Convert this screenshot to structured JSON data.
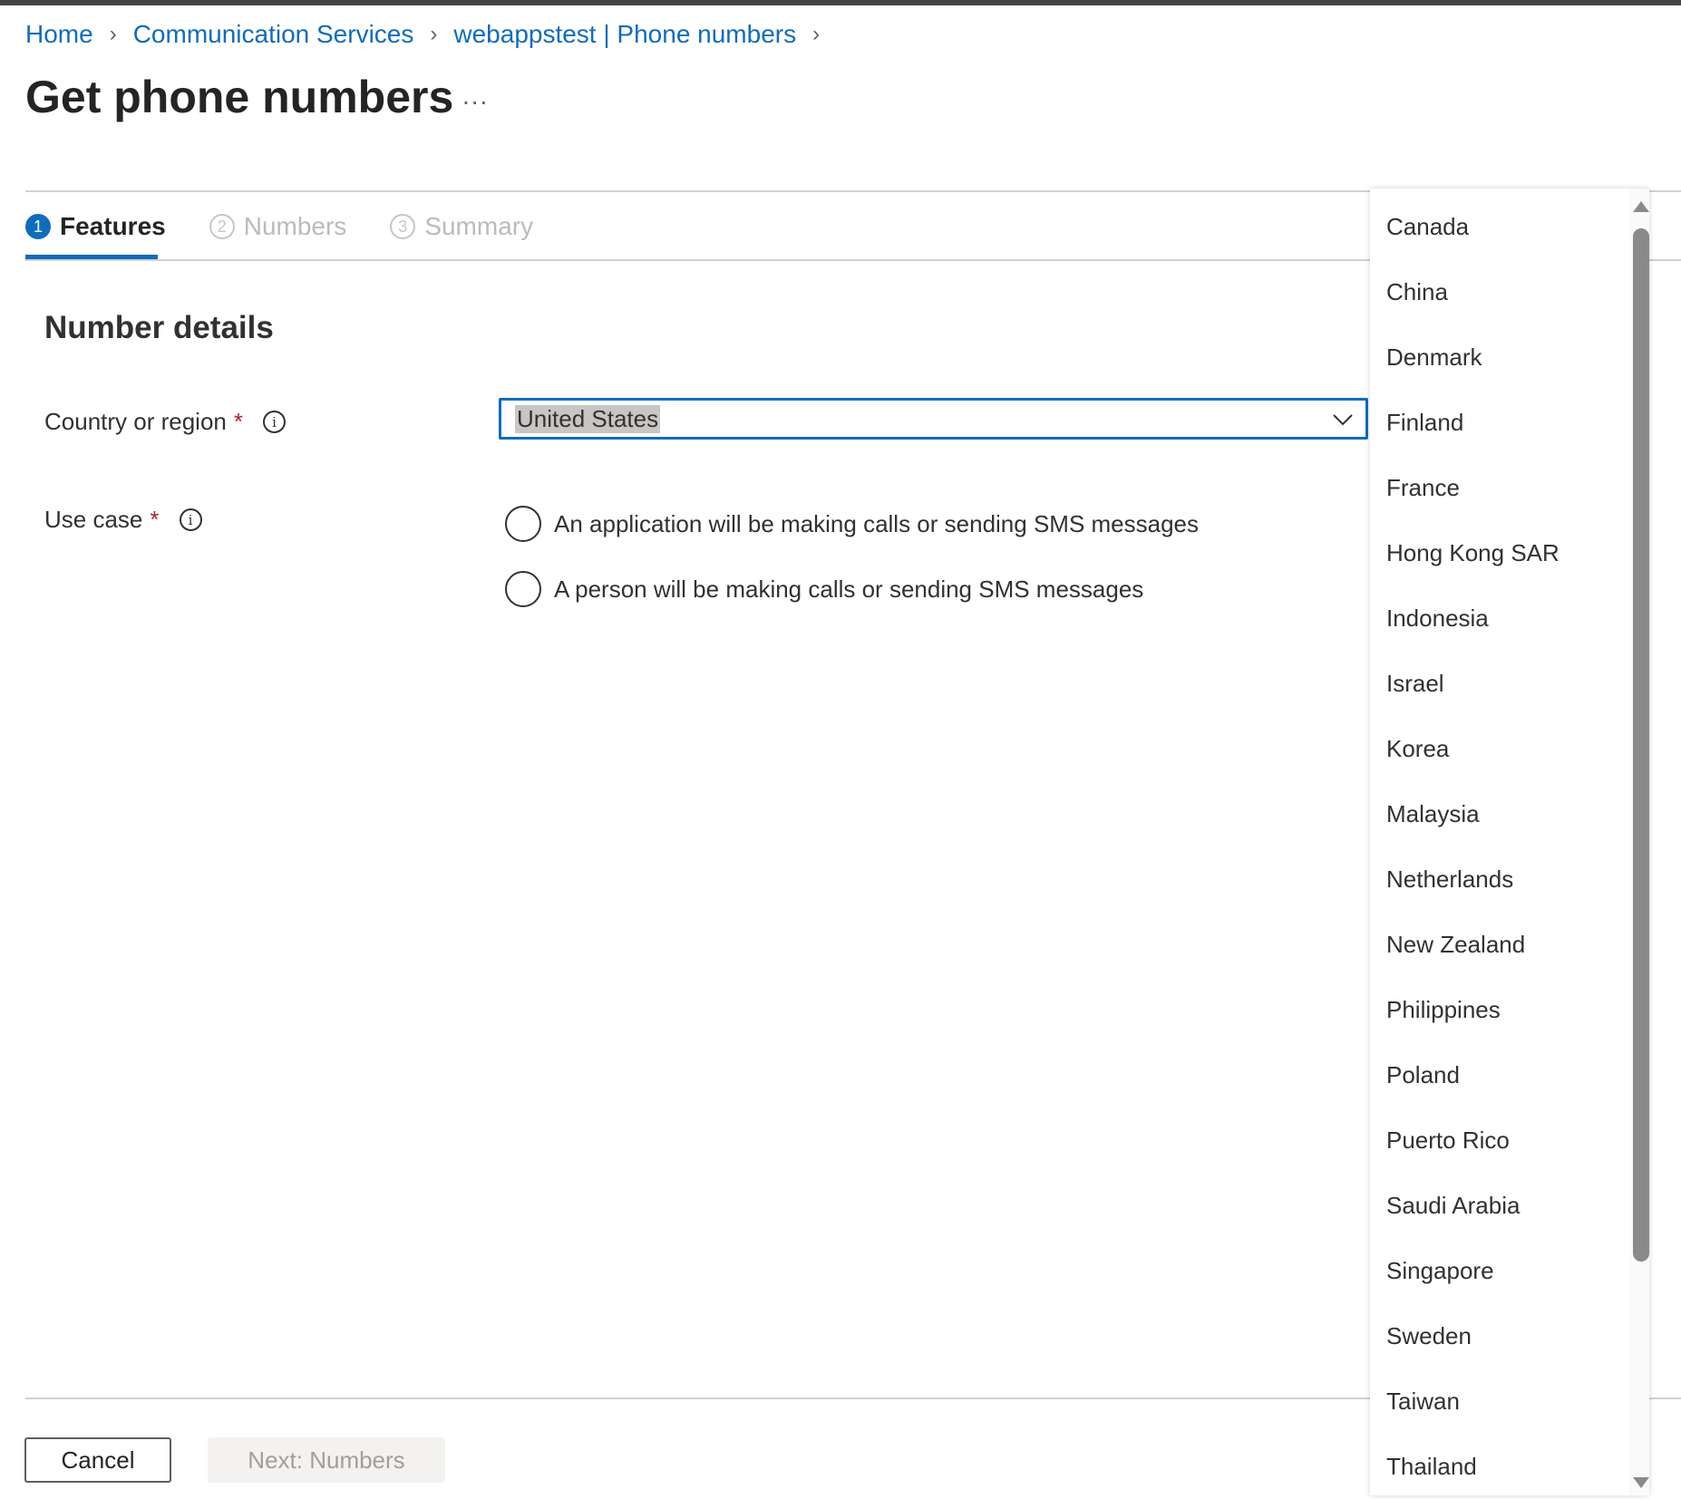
{
  "breadcrumb": [
    "Home",
    "Communication Services",
    "webappstest | Phone numbers"
  ],
  "page_title": "Get phone numbers",
  "more_label": "...",
  "tabs": [
    {
      "num": "1",
      "label": "Features"
    },
    {
      "num": "2",
      "label": "Numbers"
    },
    {
      "num": "3",
      "label": "Summary"
    }
  ],
  "section_title": "Number details",
  "country": {
    "label": "Country or region",
    "required": "*",
    "value": "United States"
  },
  "use_case": {
    "label": "Use case",
    "required": "*",
    "options": [
      "An application will be making calls or sending SMS messages",
      "A person will be making calls or sending SMS messages"
    ]
  },
  "buttons": {
    "cancel": "Cancel",
    "next": "Next: Numbers"
  },
  "dropdown_options": [
    "Canada",
    "China",
    "Denmark",
    "Finland",
    "France",
    "Hong Kong SAR",
    "Indonesia",
    "Israel",
    "Korea",
    "Malaysia",
    "Netherlands",
    "New Zealand",
    "Philippines",
    "Poland",
    "Puerto Rico",
    "Saudi Arabia",
    "Singapore",
    "Sweden",
    "Taiwan",
    "Thailand"
  ],
  "colors": {
    "accent": "#0f6cbd",
    "required": "#a4262c"
  }
}
